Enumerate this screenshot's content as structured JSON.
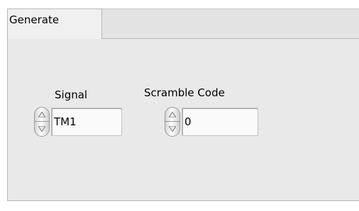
{
  "tabs": {
    "active_label": "Generate"
  },
  "controls": {
    "signal": {
      "label": "Signal",
      "value": "TM1"
    },
    "scramble_code": {
      "label": "Scramble Code",
      "value": "0"
    }
  },
  "icons": {
    "increment": "triangle-up-icon",
    "decrement": "triangle-down-icon"
  },
  "colors": {
    "panel_background": "#e9e9e9",
    "tab_background": "#f0f0f0",
    "field_background": "#fafafa"
  }
}
